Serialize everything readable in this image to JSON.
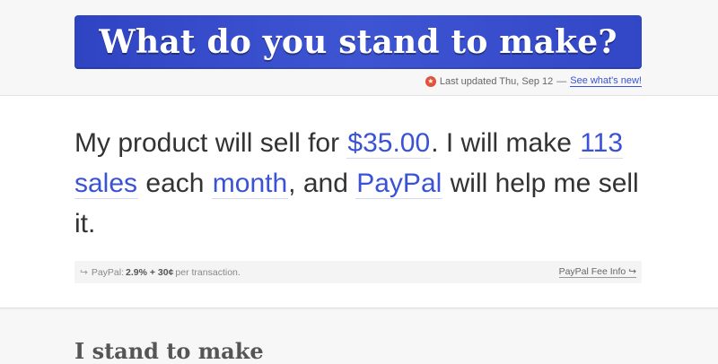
{
  "header": {
    "title": "What do you stand to make?",
    "updated_text": "Last updated Thu, Sep 12",
    "separator": "—",
    "link_text": "See what's new!"
  },
  "sentence": {
    "part1": "My product will sell for ",
    "price": "$35.00",
    "part2": ". I will make ",
    "sales": "113 sales",
    "part3": " each ",
    "period": "month",
    "part4": ", and ",
    "provider": "PayPal",
    "part5": " will help me sell it."
  },
  "fee": {
    "arrow": "↪",
    "label": "PayPal:",
    "rate": "2.9% + 30¢",
    "suffix": "per transaction.",
    "info_link": "PayPal Fee Info ↪"
  },
  "result": {
    "heading": "I stand to make"
  },
  "colors": {
    "accent": "#3a52d4",
    "banner": "#3a4fcc",
    "star": "#e0523a"
  }
}
